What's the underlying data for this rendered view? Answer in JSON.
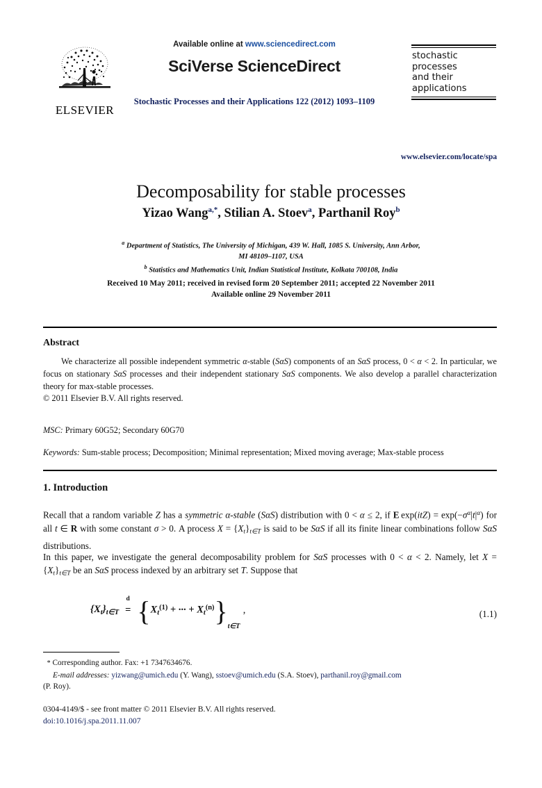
{
  "header": {
    "publisher_logo_name": "ELSEVIER",
    "available_online_prefix": "Available online at ",
    "sciencedirect_url": "www.sciencedirect.com",
    "brand": "SciVerse ScienceDirect",
    "journal_reference": "Stochastic Processes and their Applications 122 (2012) 1093–1109",
    "cover_title_lines": [
      "stochastic",
      "processes",
      "and their",
      "applications"
    ],
    "elsevier_locate_url": "www.elsevier.com/locate/spa",
    "link_color": "#12215e",
    "brand_color": "#1a1a1a"
  },
  "article": {
    "title": "Decomposability for stable processes",
    "authors": [
      {
        "name": "Yizao Wang",
        "marks": "a,*"
      },
      {
        "name": "Stilian A. Stoev",
        "marks": "a"
      },
      {
        "name": "Parthanil Roy",
        "marks": "b"
      }
    ],
    "authors_plain": "Yizao Wang a,*, Stilian A. Stoev a, Parthanil Roy b",
    "affiliations": [
      {
        "mark": "a",
        "text": "Department of Statistics, The University of Michigan, 439 W. Hall, 1085 S. University, Ann Arbor, MI 48109–1107, USA"
      },
      {
        "mark": "b",
        "text": "Statistics and Mathematics Unit, Indian Statistical Institute, Kolkata 700108, India"
      }
    ],
    "affiliation_line1": "Department of Statistics, The University of Michigan, 439 W. Hall, 1085 S. University, Ann Arbor,",
    "affiliation_line1b": "MI 48109–1107, USA",
    "affiliation_line2": "Statistics and Mathematics Unit, Indian Statistical Institute, Kolkata 700108, India",
    "history_line1": "Received 10 May 2011; received in revised form 20 September 2011; accepted 22 November 2011",
    "history_line2": "Available online 29 November 2011"
  },
  "abstract": {
    "heading": "Abstract",
    "body_line1": "We characterize all possible independent symmetric α-stable (SαS) components of an SαS process,",
    "body_line2": "0 < α < 2. In particular, we focus on stationary SαS processes and their independent stationary SαS",
    "body_line3": "components. We also develop a parallel characterization theory for max-stable processes.",
    "copyright": "© 2011 Elsevier B.V. All rights reserved.",
    "msc_label": "MSC:",
    "msc_value": "Primary 60G52; Secondary 60G70",
    "keywords_label": "Keywords:",
    "keywords_value": "Sum-stable process; Decomposition; Minimal representation; Mixed moving average; Max-stable process"
  },
  "introduction": {
    "heading": "1. Introduction",
    "para1_line1": "Recall that a random variable Z has a symmetric α-stable (SαS) distribution with 0 < α ≤ 2,",
    "para1_line2": "if E exp(itZ) = exp(−σα|t|α) for all t ∈ R with some constant σ > 0. A process X = {Xt}t∈T",
    "para1_line3": "is said to be SαS if all its finite linear combinations follow SαS distributions.",
    "para2_line1": "In this paper, we investigate the general decomposability problem for SαS processes with",
    "para2_line2": "0 < α < 2. Namely, let X = {Xt}t∈T be an SαS process indexed by an arbitrary set T. Suppose",
    "para2_line3": "that",
    "equation": {
      "lhs": "{Xt}t∈T",
      "relation": "=",
      "relation_label": "d",
      "rhs": "{Xt(1) + ··· + Xt(n)}t∈T ,",
      "number": "(1.1)",
      "lhs_base": "X",
      "lhs_sub": "t",
      "lhs_index": "t∈T",
      "term1_base": "X",
      "term1_sup": "(1)",
      "term2_base": "X",
      "term2_sup": "(n)",
      "ellipsis": "+ · · · +",
      "brace_sub": "t∈T",
      "trailing_comma": ","
    }
  },
  "footnote": {
    "star": "*",
    "corresponding": "Corresponding author. Fax: +1 7347634676.",
    "email_label": "E-mail addresses:",
    "emails": [
      {
        "address": "yizwang@umich.edu",
        "owner": "(Y. Wang)"
      },
      {
        "address": "sstoev@umich.edu",
        "owner": "(S.A. Stoev)"
      },
      {
        "address": "parthanil.roy@gmail.com",
        "owner": "(P. Roy)"
      }
    ],
    "email_a": "yizwang@umich.edu",
    "email_a_owner": "(Y. Wang),",
    "email_b": "sstoev@umich.edu",
    "email_b_owner": "(S.A. Stoev),",
    "email_c": "parthanil.roy@gmail.com",
    "email_c_owner": "(P. Roy)."
  },
  "colophon": {
    "issn_line": "0304-4149/$ - see front matter © 2011 Elsevier B.V. All rights reserved.",
    "doi": "doi:10.1016/j.spa.2011.11.007"
  }
}
